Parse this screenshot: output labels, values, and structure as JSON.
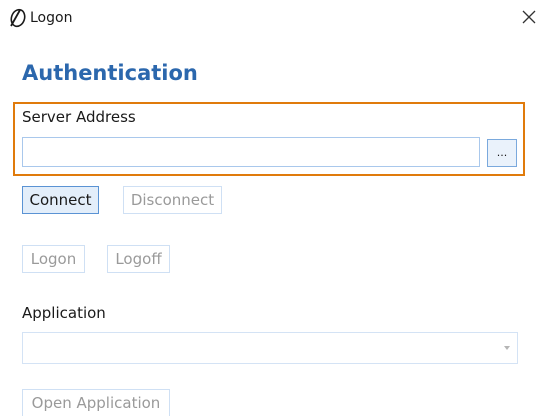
{
  "window": {
    "title": "Logon",
    "app_icon": "logon-logo-icon",
    "close_icon": "close-icon"
  },
  "authentication": {
    "heading": "Authentication",
    "server_address": {
      "label": "Server Address",
      "value": "",
      "placeholder": "",
      "browse_label": "..."
    },
    "connect_label": "Connect",
    "disconnect_label": "Disconnect",
    "logon_label": "Logon",
    "logoff_label": "Logoff",
    "application": {
      "label": "Application",
      "selected": ""
    },
    "open_application_label": "Open Application"
  },
  "colors": {
    "heading": "#2b67ad",
    "highlight_border": "#e07b0c",
    "active_button_border": "#5a93d4",
    "disabled_text": "#9a9a9a"
  }
}
